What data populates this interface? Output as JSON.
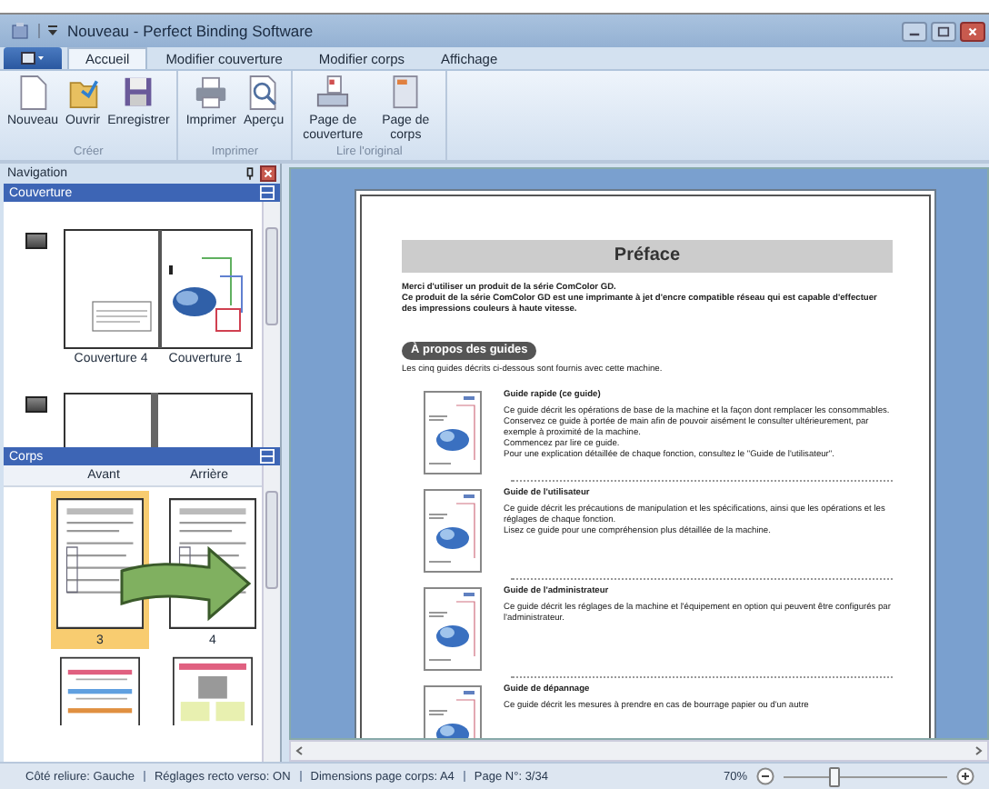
{
  "window": {
    "title": "Nouveau - Perfect Binding Software"
  },
  "tabs": [
    {
      "label": "Accueil",
      "selected": true
    },
    {
      "label": "Modifier couverture",
      "selected": false
    },
    {
      "label": "Modifier corps",
      "selected": false
    },
    {
      "label": "Affichage",
      "selected": false
    }
  ],
  "ribbon_groups": [
    {
      "label": "Créer",
      "buttons": [
        {
          "label": "Nouveau",
          "kind": "new"
        },
        {
          "label": "Ouvrir",
          "kind": "open"
        },
        {
          "label": "Enregistrer",
          "kind": "save"
        }
      ]
    },
    {
      "label": "Imprimer",
      "buttons": [
        {
          "label": "Imprimer",
          "kind": "print"
        },
        {
          "label": "Aperçu",
          "kind": "preview"
        }
      ]
    },
    {
      "label": "Lire l'original",
      "buttons": [
        {
          "label": "Page de couverture",
          "kind": "cover"
        },
        {
          "label": "Page de corps",
          "kind": "body"
        }
      ]
    }
  ],
  "navigation": {
    "title": "Navigation",
    "cover_section": {
      "title": "Couverture",
      "thumbnails": [
        "Couverture 4",
        "Couverture 1"
      ]
    },
    "body_section": {
      "title": "Corps",
      "columns": [
        "Avant",
        "Arrière"
      ],
      "pages": [
        {
          "label": "3",
          "selected": true
        },
        {
          "label": "4",
          "selected": false
        }
      ]
    }
  },
  "document": {
    "heading": "Préface",
    "intro": [
      "Merci d'utiliser un produit de la série ComColor GD.",
      "Ce produit de la série ComColor GD est une imprimante à jet d'encre compatible réseau qui est capable d'effectuer des impressions couleurs à haute vitesse."
    ],
    "section": "À propos des guides",
    "section_intro": "Les cinq guides décrits ci-dessous sont fournis avec cette machine.",
    "guides": [
      {
        "title": "Guide rapide (ce guide)",
        "lines": [
          "Ce guide décrit les opérations de base de la machine et la façon dont remplacer les consommables.",
          "Conservez ce guide à portée de main afin de pouvoir aisément le consulter ultérieurement, par exemple à proximité de la machine.",
          "Commencez par lire ce guide.",
          "Pour une explication détaillée de chaque fonction, consultez le \"Guide de l'utilisateur\"."
        ]
      },
      {
        "title": "Guide de l'utilisateur",
        "lines": [
          "Ce guide décrit les précautions de manipulation et les spécifications, ainsi que les opérations et les réglages de chaque fonction.",
          "Lisez ce guide pour une compréhension plus détaillée de la machine."
        ]
      },
      {
        "title": "Guide de l'administrateur",
        "lines": [
          "Ce guide décrit les réglages de la machine et l'équipement en option qui peuvent être configurés par l'administrateur."
        ]
      },
      {
        "title": "Guide de dépannage",
        "lines": [
          "Ce guide décrit les mesures à prendre en cas de bourrage papier ou d'un autre"
        ]
      }
    ]
  },
  "status_bar": {
    "items": [
      "Côté reliure: Gauche",
      "Réglages recto verso: ON",
      "Dimensions page corps: A4",
      "Page N°: 3/34"
    ],
    "zoom": "70%",
    "zoom_slider": {
      "level": 0.3
    }
  }
}
